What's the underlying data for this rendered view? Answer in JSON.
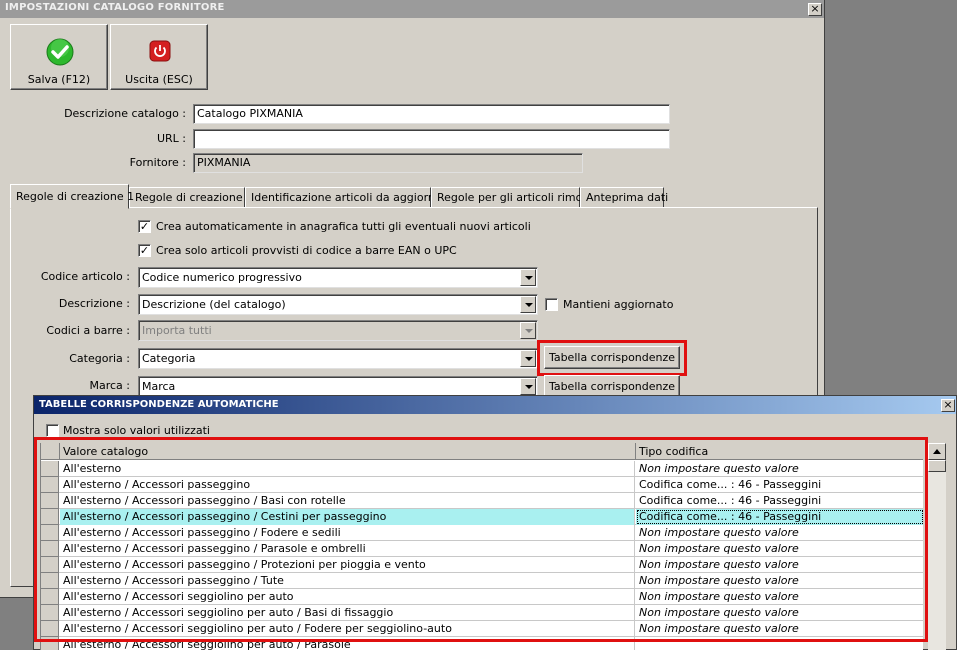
{
  "main_window": {
    "title": "IMPOSTAZIONI CATALOGO FORNITORE",
    "close_glyph": "×"
  },
  "toolbar": {
    "save_label": "Salva (F12)",
    "save_icon": "check-icon",
    "save_icon_color": "#2db82d",
    "exit_label": "Uscita (ESC)",
    "exit_icon": "power-icon",
    "exit_icon_color": "#d42020"
  },
  "form": {
    "descrizione_label": "Descrizione catalogo :",
    "descrizione_value": "Catalogo PIXMANIA",
    "url_label": "URL :",
    "url_value": "",
    "fornitore_label": "Fornitore :",
    "fornitore_value": "PIXMANIA"
  },
  "tabs": [
    {
      "label": "Regole di creazione 1",
      "active": true
    },
    {
      "label": "Regole di creazione 2",
      "active": false
    },
    {
      "label": "Identificazione articoli da aggiornare",
      "active": false
    },
    {
      "label": "Regole per gli articoli rimossi",
      "active": false
    },
    {
      "label": "Anteprima dati",
      "active": false
    }
  ],
  "rules": {
    "check_create_new": "Crea automaticamente in anagrafica tutti gli eventuali nuovi articoli",
    "check_only_ean": "Crea solo articoli provvisti di codice a barre EAN o UPC",
    "check_mark": "✓",
    "codice_label": "Codice articolo :",
    "codice_value": "Codice numerico progressivo",
    "descrizione_label": "Descrizione :",
    "descrizione_value": "Descrizione (del catalogo)",
    "mantieni_label": "Mantieni aggiornato",
    "barre_label": "Codici a barre :",
    "barre_value": "Importa tutti",
    "categoria_label": "Categoria :",
    "categoria_value": "Categoria",
    "tabella_button": "Tabella corrispondenze",
    "marca_label": "Marca :",
    "marca_value": "Marca",
    "tabella_button_2": "Tabella corrispondenze"
  },
  "dialog": {
    "title": "TABELLE CORRISPONDENZE AUTOMATICHE",
    "close_glyph": "×",
    "show_used_label": "Mostra solo valori utilizzati",
    "col_valore": "Valore catalogo",
    "col_tipo": "Tipo codifica",
    "rows": [
      {
        "valore": "All'esterno",
        "tipo": "Non impostare questo valore",
        "italic": true,
        "selected": false
      },
      {
        "valore": "All'esterno / Accessori passeggino",
        "tipo": "Codifica come... : 46 - Passeggini",
        "italic": false,
        "selected": false
      },
      {
        "valore": "All'esterno / Accessori passeggino / Basi con rotelle",
        "tipo": "Codifica come... : 46 - Passeggini",
        "italic": false,
        "selected": false
      },
      {
        "valore": "All'esterno / Accessori passeggino / Cestini per passeggino",
        "tipo": "Codifica come... : 46 - Passeggini",
        "italic": false,
        "selected": true
      },
      {
        "valore": "All'esterno / Accessori passeggino / Fodere e sedili",
        "tipo": "Non impostare questo valore",
        "italic": true,
        "selected": false
      },
      {
        "valore": "All'esterno / Accessori passeggino / Parasole e ombrelli",
        "tipo": "Non impostare questo valore",
        "italic": true,
        "selected": false
      },
      {
        "valore": "All'esterno / Accessori passeggino / Protezioni per pioggia e vento",
        "tipo": "Non impostare questo valore",
        "italic": true,
        "selected": false
      },
      {
        "valore": "All'esterno / Accessori passeggino / Tute",
        "tipo": "Non impostare questo valore",
        "italic": true,
        "selected": false
      },
      {
        "valore": "All'esterno / Accessori seggiolino per auto",
        "tipo": "Non impostare questo valore",
        "italic": true,
        "selected": false
      },
      {
        "valore": "All'esterno / Accessori seggiolino per auto / Basi di fissaggio",
        "tipo": "Non impostare questo valore",
        "italic": true,
        "selected": false
      },
      {
        "valore": "All'esterno / Accessori seggiolino per auto / Fodere per seggiolino-auto",
        "tipo": "Non impostare questo valore",
        "italic": true,
        "selected": false
      },
      {
        "valore": "All'esterno / Accessori seggiolino per auto / Parasole",
        "tipo": "",
        "italic": false,
        "selected": false
      }
    ]
  }
}
